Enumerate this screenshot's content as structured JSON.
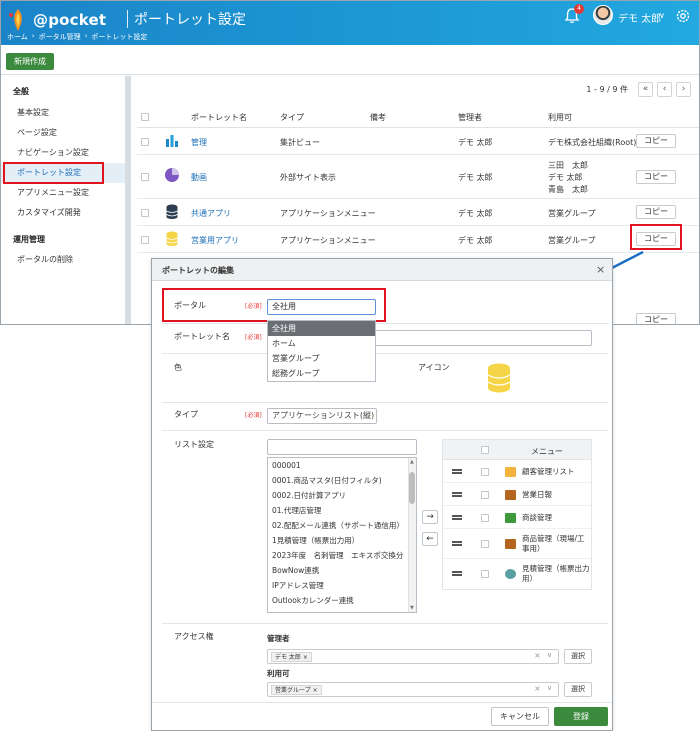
{
  "header": {
    "logo_text": "@pocket",
    "title": "ポートレット設定",
    "breadcrumb": [
      "ホーム",
      "›",
      "ポータル管理",
      "›",
      "ポートレット設定"
    ],
    "notification_count": "4",
    "user_name": "デモ 太郎",
    "user_chevron": "∨"
  },
  "actions": {
    "new_button": "新規作成"
  },
  "sidebar": {
    "section_general": "全般",
    "items": [
      "基本設定",
      "ページ設定",
      "ナビゲーション設定",
      "ポートレット設定",
      "アプリメニュー設定",
      "カスタマイズ開発"
    ],
    "section_ops": "運用管理",
    "ops_items": [
      "ポータルの削除"
    ]
  },
  "pager": {
    "text": "1 - 9 / 9 件",
    "first": "«",
    "prev": "‹",
    "next": "›"
  },
  "grid": {
    "columns": [
      "ポートレット名",
      "タイプ",
      "備考",
      "管理者",
      "利用可"
    ],
    "copy_label": "コピー",
    "rows": [
      {
        "name": "管理",
        "type": "集計ビュー",
        "admin": "デモ 太郎",
        "usable": [
          "デモ株式会社組織(Root)"
        ],
        "icon": "bar-chart-icon"
      },
      {
        "name": "動画",
        "type": "外部サイト表示",
        "admin": "デモ 太郎",
        "usable": [
          "三田　太郎",
          "デモ 太郎",
          "青島　太郎"
        ],
        "icon": "pie-chart-icon"
      },
      {
        "name": "共通アプリ",
        "type": "アプリケーションメニュー",
        "admin": "デモ 太郎",
        "usable": [
          "営業グループ"
        ],
        "icon": "database-icon"
      },
      {
        "name": "営業用アプリ",
        "type": "アプリケーションメニュー",
        "admin": "デモ 太郎",
        "usable": [
          "営業グループ"
        ],
        "icon": "database-yellow-icon"
      }
    ]
  },
  "modal": {
    "title": "ポートレットの編集",
    "close": "×",
    "required": "[必須]",
    "portal_label": "ポータル",
    "portal_value": "全社用",
    "portal_options": [
      "全社用",
      "ホーム",
      "営業グループ",
      "総務グループ"
    ],
    "portlet_name_label": "ポートレット名",
    "color_label": "色",
    "icon_label": "アイコン",
    "type_label": "タイプ",
    "type_value": "アプリケーションリスト(縦)",
    "list_label": "リスト設定",
    "list_items": [
      "000001",
      "0001.商品マスタ(日付フィルタ)",
      "0002.日付計算アプリ",
      "01.代理店管理",
      "02.配配メール連携（サポート通信用）",
      "1見積管理（帳票出力用）",
      "2023年度　名刺管理　エキスポ交換分",
      "BowNow連携",
      "IPアドレス管理",
      "Outlookカレンダー連携"
    ],
    "move_right": "→",
    "move_left": "←",
    "menu_header": "メニュー",
    "menu_items": [
      {
        "label": "顧客管理リスト",
        "icon": "customer-list-icon",
        "color": "#f2b43c"
      },
      {
        "label": "営業日報",
        "icon": "briefcase-icon",
        "color": "#b5651d"
      },
      {
        "label": "商談管理",
        "icon": "book-icon",
        "color": "#3c9a3c"
      },
      {
        "label": "商品管理（現場/工事用）",
        "icon": "briefcase-icon",
        "color": "#b5651d"
      },
      {
        "label": "見積管理（帳票出力用）",
        "icon": "estimate-icon",
        "color": "#5aa0a0"
      }
    ],
    "access_label": "アクセス権",
    "admin_label": "管理者",
    "admin_tag": "デモ 太郎",
    "usable_label": "利用可",
    "usable_tag": "営業グループ",
    "tag_remove": "×",
    "clear": "×",
    "chevron": "∨",
    "select_button": "選択",
    "cancel_button": "キャンセル",
    "save_button": "登録"
  },
  "colors": {
    "topbar": "#1d9ad6",
    "primary_green": "#3b8a3e",
    "highlight_red": "#e0141e",
    "link": "#1d6fb8"
  }
}
